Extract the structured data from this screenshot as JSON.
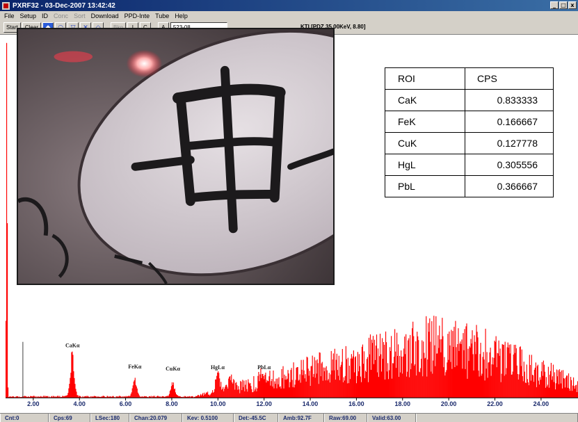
{
  "window": {
    "title": "PXRF32 - 03-Dec-2007 13:42:42",
    "controls": [
      "_",
      "□",
      "x"
    ]
  },
  "menu": {
    "items": [
      {
        "label": "File",
        "enabled": true
      },
      {
        "label": "Setup",
        "enabled": true
      },
      {
        "label": "ID",
        "enabled": true
      },
      {
        "label": "Conc",
        "enabled": false
      },
      {
        "label": "Sort",
        "enabled": false
      },
      {
        "label": "Download",
        "enabled": true
      },
      {
        "label": "PPD-Inte",
        "enabled": true
      },
      {
        "label": "Tube",
        "enabled": true
      },
      {
        "label": "Help",
        "enabled": true
      }
    ]
  },
  "toolbar": {
    "start_label": "Start",
    "clear_label": "Clear",
    "icon_buttons": [
      "◆",
      "◠",
      "▽",
      "✕",
      "◇"
    ],
    "bkg_label": "Bkg",
    "i_label": "I",
    "c_label": "C",
    "a_label": "A",
    "sample_value": "523-08",
    "status_text": "KTI  [PDZ 35.00KeV, 8.80]"
  },
  "roi_table": {
    "headers": [
      "ROI",
      "CPS"
    ],
    "rows": [
      [
        "CaK",
        "0.833333"
      ],
      [
        "FeK",
        "0.166667"
      ],
      [
        "CuK",
        "0.127778"
      ],
      [
        "HgL",
        "0.305556"
      ],
      [
        "PbL",
        "0.366667"
      ]
    ]
  },
  "chart_data": {
    "type": "bar",
    "xlim": [
      0.8,
      25.6
    ],
    "x_ticks": [
      "2.00",
      "4.00",
      "6.00",
      "8.00",
      "10.00",
      "12.00",
      "14.00",
      "16.00",
      "18.00",
      "20.00",
      "22.00",
      "24.00"
    ],
    "x_tick_values": [
      2,
      4,
      6,
      8,
      10,
      12,
      14,
      16,
      18,
      20,
      22,
      24
    ],
    "annotations": [
      {
        "label": "CaKα",
        "x": 3.7
      },
      {
        "label": "FeKα",
        "x": 6.4
      },
      {
        "label": "CuKα",
        "x": 8.05
      },
      {
        "label": "HgLα",
        "x": 9.99
      },
      {
        "label": "PbLα",
        "x": 10.55
      }
    ],
    "peaks": [
      {
        "x": 0.85,
        "height": 1.0
      },
      {
        "x": 3.69,
        "height": 0.128
      },
      {
        "x": 6.4,
        "height": 0.05
      },
      {
        "x": 8.04,
        "height": 0.04
      },
      {
        "x": 9.99,
        "height": 0.055
      },
      {
        "x": 10.55,
        "height": 0.04
      },
      {
        "x": 11.92,
        "height": 0.045
      }
    ],
    "background_peak_center": 19.2,
    "background_peak_height": 0.16,
    "bar_color": "#ff0000"
  },
  "status_bar": [
    "Cnt:0",
    "Cps:69",
    "LSec:180",
    "Chan:20.079",
    "Kev: 0.5100",
    "Det:-45.5C",
    "Amb:92.7F",
    "Raw:69.00",
    "Valid:63.00"
  ]
}
